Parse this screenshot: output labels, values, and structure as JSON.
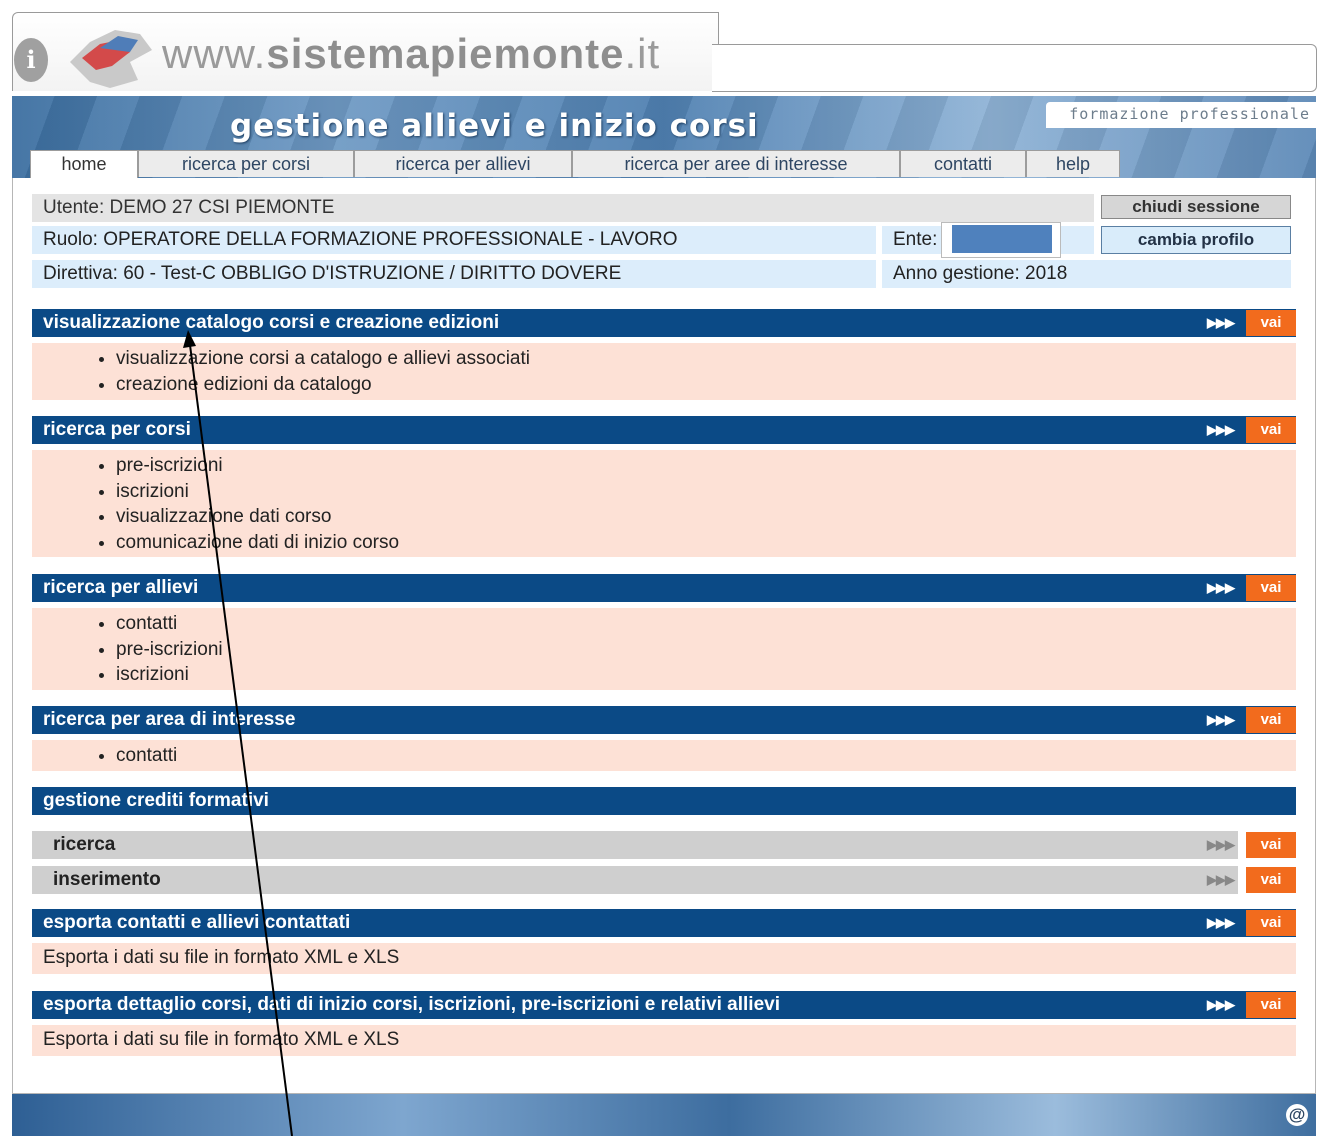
{
  "portal": {
    "url_prefix": "www.",
    "url_bold": "sistemapiemonte",
    "url_suffix": ".it",
    "info_icon": "info-icon"
  },
  "banner": {
    "title": "gestione allievi e inizio corsi",
    "section": "formazione professionale"
  },
  "tabs": [
    {
      "label": "home"
    },
    {
      "label": "ricerca per corsi"
    },
    {
      "label": "ricerca per allievi"
    },
    {
      "label": "ricerca per aree di interesse"
    },
    {
      "label": "contatti"
    },
    {
      "label": "help"
    }
  ],
  "user": {
    "utente_label": "Utente:",
    "utente_value": "DEMO 27 CSI PIEMONTE",
    "ruolo": "Ruolo: OPERATORE DELLA FORMAZIONE PROFESSIONALE - LAVORO",
    "direttiva": "Direttiva: 60 - Test-C OBBLIGO D'ISTRUZIONE / DIRITTO DOVERE",
    "ente_label": "Ente:",
    "anno": "Anno gestione: 2018",
    "chiudi_button": "chiudi sessione",
    "cambia_button": "cambia profilo"
  },
  "arrows": "▶▶▶",
  "vai_label": "vai",
  "sections": {
    "catalogo": {
      "title": "visualizzazione catalogo corsi e creazione edizioni",
      "items": [
        "visualizzazione corsi a catalogo e allievi associati",
        "creazione edizioni da catalogo"
      ]
    },
    "corsi": {
      "title": "ricerca per corsi",
      "items": [
        "pre-iscrizioni",
        "iscrizioni",
        "visualizzazione dati corso",
        "comunicazione dati di inizio corso"
      ]
    },
    "allievi": {
      "title": "ricerca per allievi",
      "items": [
        "contatti",
        "pre-iscrizioni",
        "iscrizioni"
      ]
    },
    "area": {
      "title": "ricerca per area di interesse",
      "items": [
        "contatti"
      ]
    },
    "crediti": {
      "title": "gestione crediti formativi",
      "rows": [
        "ricerca",
        "inserimento"
      ]
    },
    "esporta_contatti": {
      "title": "esporta contatti e allievi contattati",
      "text": "Esporta i dati su file in formato XML e XLS"
    },
    "esporta_dettaglio": {
      "title": "esporta dettaglio corsi, dati di inizio corsi, iscrizioni, pre-iscrizioni e relativi allievi",
      "text": "Esporta i dati su file in formato XML e XLS"
    }
  },
  "footer": {
    "at_symbol": "@"
  },
  "colors": {
    "header_blue": "#0b4a86",
    "body_peach": "#fde1d6",
    "vai_orange": "#f26b1d",
    "info_blue": "#dcedfb"
  }
}
